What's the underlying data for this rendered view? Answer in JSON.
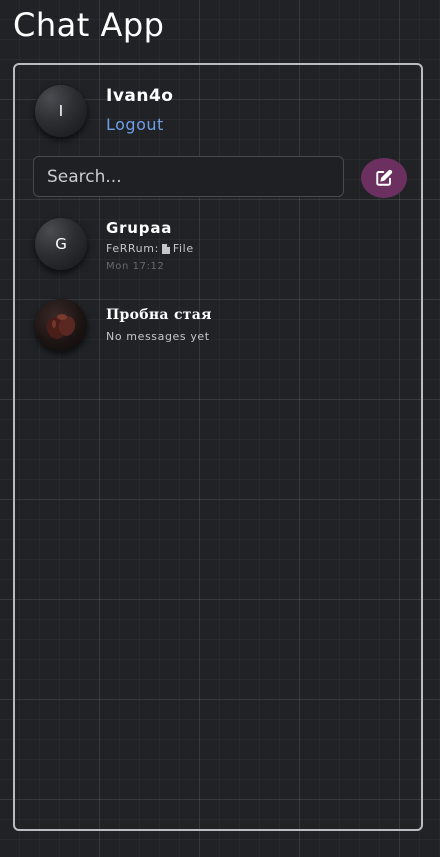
{
  "app": {
    "title": "Chat App"
  },
  "user": {
    "avatar_initial": "I",
    "name": "Ivan4o",
    "logout_label": "Logout"
  },
  "search": {
    "placeholder": "Search..."
  },
  "new_chat_button": {
    "icon": "edit-icon"
  },
  "chats": [
    {
      "name": "Grupaa",
      "avatar_initial": "G",
      "preview_sender": "FeRRum:",
      "preview_icon": "file-icon",
      "preview_text": "File",
      "time": "Mon 17:12"
    },
    {
      "name": "Пробна стая",
      "avatar_icon": "photo-avatar",
      "preview_text": "No messages yet"
    }
  ],
  "colors": {
    "background": "#202226",
    "panel_border": "#b9bcc2",
    "link": "#6e9fe8",
    "accent_button": "#6b3060"
  }
}
